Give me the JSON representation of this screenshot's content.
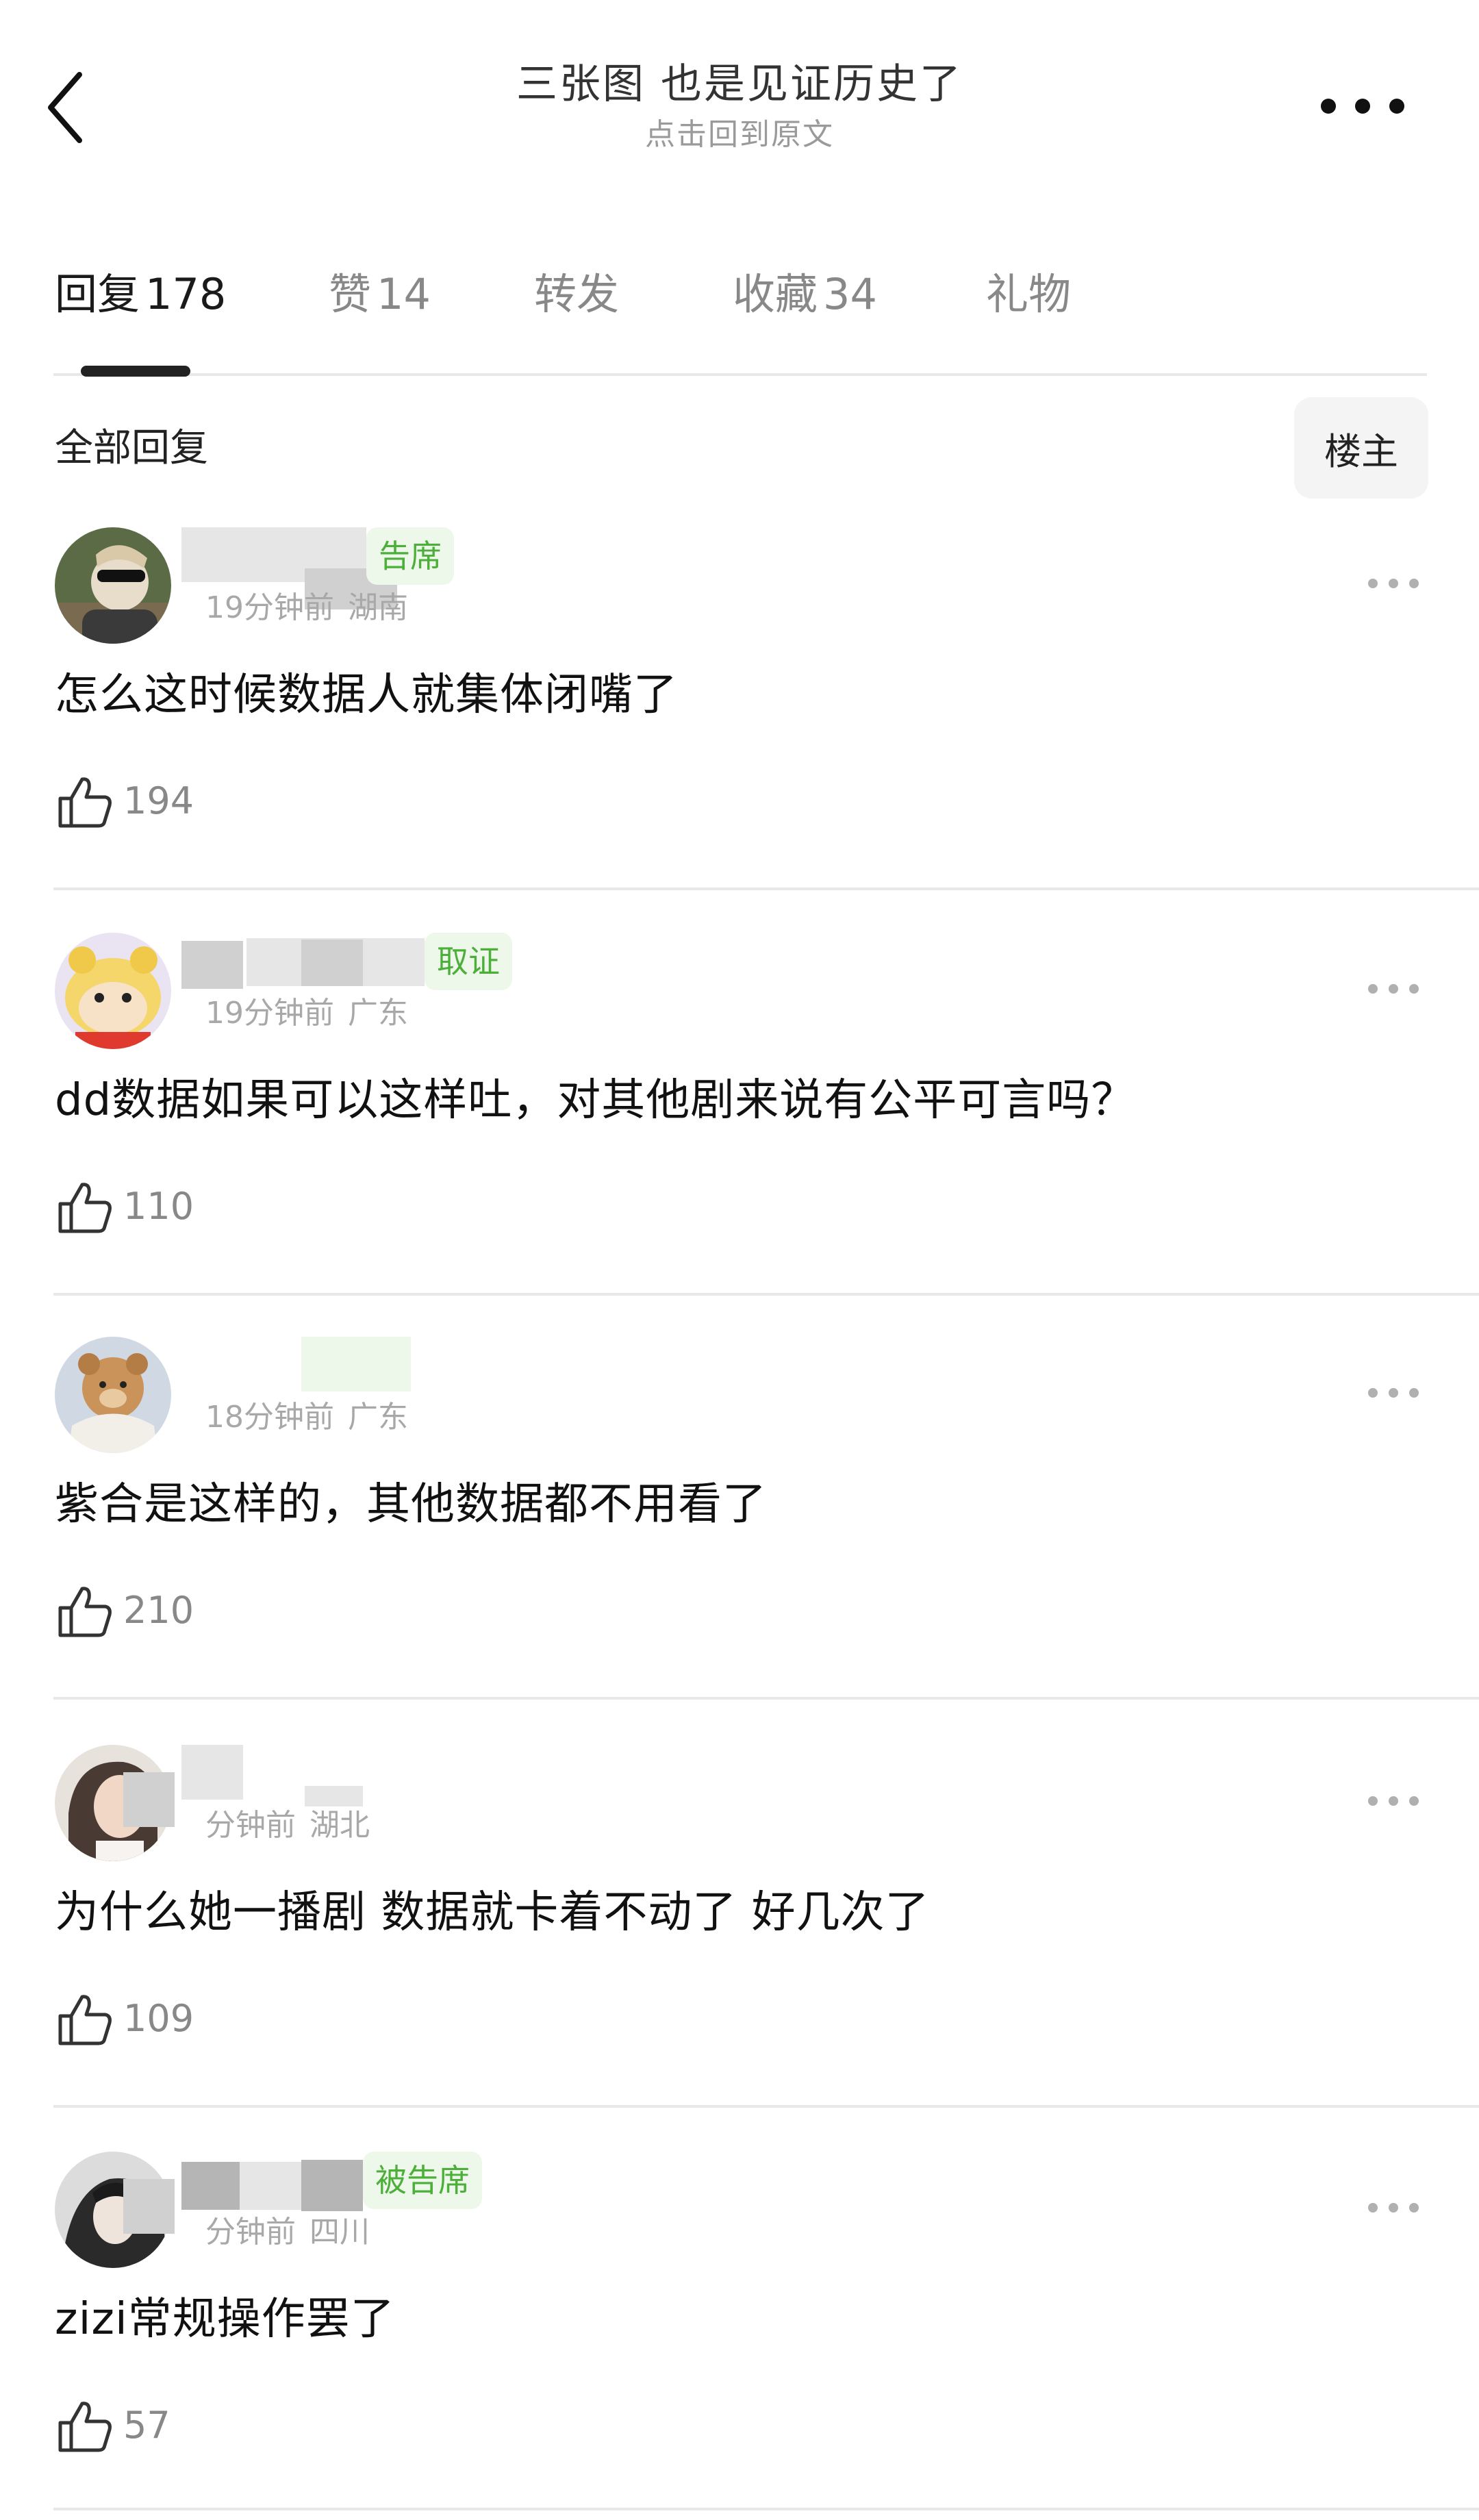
{
  "header": {
    "title": "三张图 也是见证历史了",
    "subtitle": "点击回到原文"
  },
  "tabs": [
    {
      "label": "回复",
      "count": "178",
      "active": true
    },
    {
      "label": "赞",
      "count": "14",
      "active": false
    },
    {
      "label": "转发",
      "count": "",
      "active": false
    },
    {
      "label": "收藏",
      "count": "34",
      "active": false
    },
    {
      "label": "礼物",
      "count": "",
      "active": false
    }
  ],
  "section": {
    "title": "全部回复",
    "op_filter": "楼主"
  },
  "comments": [
    {
      "badge": "告席",
      "time": "19分钟前",
      "location": "湖南",
      "text": "怎么这时候数据人就集体闭嘴了",
      "likes": "194"
    },
    {
      "badge": "取证",
      "time": "19分钟前",
      "location": "广东",
      "text": "dd数据如果可以这样吐，对其他剧来说有公平可言吗？",
      "likes": "110"
    },
    {
      "badge": "",
      "time": "18分钟前",
      "location": "广东",
      "text": "紫合是这样的，其他数据都不用看了",
      "likes": "210"
    },
    {
      "badge": "",
      "time": "分钟前",
      "location": "湖北",
      "text": "为什么她一播剧 数据就卡着不动了 好几次了",
      "likes": "109"
    },
    {
      "badge": "被告席",
      "time": "分钟前",
      "location": "四川",
      "text": "zizi常规操作罢了",
      "likes": "57"
    }
  ],
  "colors": {
    "badge_text": "#4caf3a",
    "badge_bg": "#eef8ea",
    "muted": "#a8a8a8",
    "divider": "#e8e8e8"
  },
  "icons": {
    "back": "back-arrow-icon",
    "more": "more-dots-icon",
    "like": "thumbs-up-icon"
  }
}
